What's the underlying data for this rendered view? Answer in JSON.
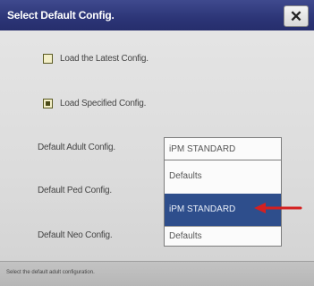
{
  "dialog": {
    "title": "Select Default Config.",
    "close_label": "✕"
  },
  "options": {
    "load_latest": {
      "label": "Load the Latest Config.",
      "checked": false
    },
    "load_specified": {
      "label": "Load Specified Config.",
      "checked": true
    }
  },
  "fields": {
    "adult_label": "Default Adult Config.",
    "ped_label": "Default Ped Config.",
    "neo_label": "Default Neo Config."
  },
  "select": {
    "value": "iPM STANDARD",
    "options": [
      "Defaults",
      "iPM STANDARD",
      "Defaults"
    ],
    "selected_index": 1
  },
  "status": {
    "text": "Select the default adult configuration."
  },
  "colors": {
    "titlebar": "#2c3577",
    "selection": "#2e4e8c",
    "annotation_arrow": "#d42020"
  }
}
